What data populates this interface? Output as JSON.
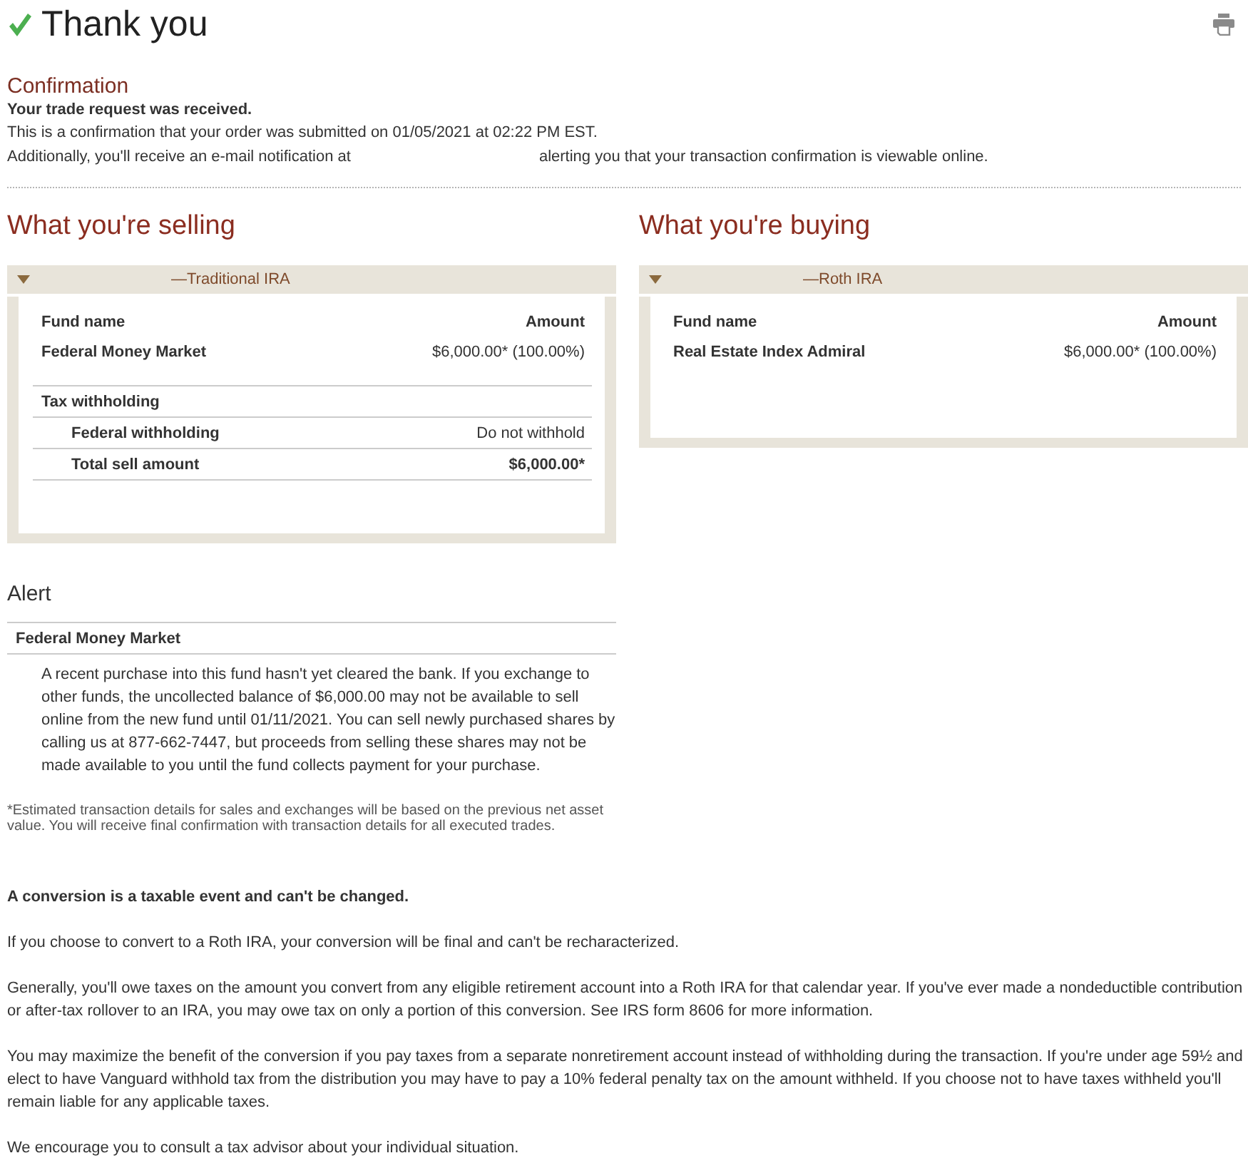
{
  "header": {
    "title": "Thank you"
  },
  "confirmation": {
    "heading": "Confirmation",
    "status": "Your trade request was received.",
    "lines": [
      "This is a confirmation that your order was submitted on 01/05/2021 at 02:22 PM EST."
    ],
    "email_notice": [
      "Additionally, you'll receive an e-mail notification at",
      "alerting you that your transaction confirmation is viewable online."
    ]
  },
  "selling": {
    "heading": "What you're selling",
    "account": {
      "label": "—Traditional IRA",
      "expanded": true
    },
    "columns": [
      "Fund name",
      "Amount"
    ],
    "funds": [
      {
        "name": "Federal Money Market",
        "amount": "$6,000.00* (100.00%)"
      }
    ],
    "tax_withholding": {
      "heading": "Tax withholding",
      "rows": [
        {
          "kind": "detail",
          "label": "Federal withholding",
          "value": "Do not withhold"
        },
        {
          "kind": "total",
          "label": "Total sell amount",
          "value": "$6,000.00*"
        }
      ]
    }
  },
  "buying": {
    "heading": "What you're buying",
    "account": {
      "label": "—Roth IRA",
      "expanded": true
    },
    "columns": [
      "Fund name",
      "Amount"
    ],
    "funds": [
      {
        "name": "Real Estate Index Admiral",
        "amount": "$6,000.00* (100.00%)"
      }
    ]
  },
  "alert": {
    "heading": "Alert",
    "fund": "Federal Money Market",
    "message": "A recent purchase into this fund hasn't yet cleared the bank. If you exchange to other funds, the uncollected balance of $6,000.00 may not be available to sell online from the new fund until 01/11/2021. You can sell newly purchased shares by calling us at 877-662-7447, but proceeds from selling these shares may not be made available to you until the fund collects payment for your purchase."
  },
  "footnote": "*Estimated transaction details for sales and exchanges will be based on the previous net asset value. You will receive final confirmation with transaction details for all executed trades.",
  "conversion_notice": {
    "heading": "A conversion is a taxable event and can't be changed.",
    "paragraphs": [
      "If you choose to convert to a Roth IRA, your conversion will be final and can't be recharacterized.",
      "Generally, you'll owe taxes on the amount you convert from any eligible retirement account into a Roth IRA for that calendar year. If you've ever made a nondeductible contribution or after-tax rollover to an IRA, you may owe tax on only a portion of this conversion. See IRS form 8606 for more information.",
      "You may maximize the benefit of the conversion if you pay taxes from a separate nonretirement account instead of withholding during the transaction. If you're under age 59½ and elect to have Vanguard withhold tax from the distribution you may have to pay a 10% federal penalty tax on the amount withheld. If you choose not to have taxes withheld you'll remain liable for any applicable taxes.",
      "We encourage you to consult a tax advisor about your individual situation."
    ]
  }
}
